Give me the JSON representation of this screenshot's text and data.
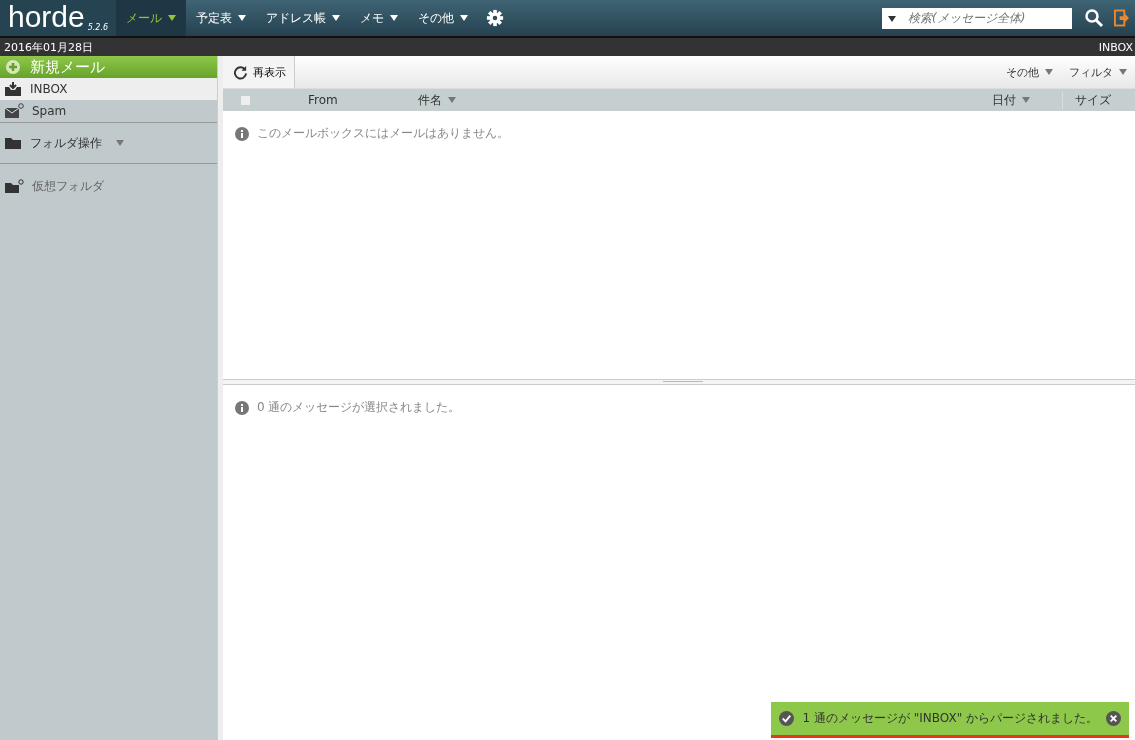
{
  "header": {
    "logo": "horde",
    "version": "5.2.6",
    "menu": [
      {
        "label": "メール",
        "selected": true
      },
      {
        "label": "予定表",
        "selected": false
      },
      {
        "label": "アドレス帳",
        "selected": false
      },
      {
        "label": "メモ",
        "selected": false
      },
      {
        "label": "その他",
        "selected": false
      }
    ],
    "search": {
      "placeholder": "検索(メッセージ全体)"
    }
  },
  "date_bar": {
    "date": "2016年01月28日",
    "mailbox": "INBOX"
  },
  "sidebar": {
    "new_mail": "新規メール",
    "folders": [
      {
        "label": "INBOX",
        "kind": "inbox",
        "selected": true
      },
      {
        "label": "Spam",
        "kind": "spam",
        "selected": false
      }
    ],
    "folder_actions": "フォルダ操作",
    "virtual_folders": "仮想フォルダ"
  },
  "toolbar": {
    "refresh": "再表示",
    "other": "その他",
    "filter": "フィルタ"
  },
  "table": {
    "select_all": {
      "checked": false
    },
    "columns": [
      {
        "label": "From",
        "sortable": false
      },
      {
        "label": "件名",
        "sortable": true
      },
      {
        "label": "日付",
        "sortable": true
      },
      {
        "label": "サイズ",
        "sortable": false
      }
    ],
    "empty_message": "このメールボックスにはメールはありません。"
  },
  "preview": {
    "message": "0 通のメッセージが選択されました。"
  },
  "notification": {
    "message": "1 通のメッセージが \"INBOX\" からパージされました。"
  }
}
